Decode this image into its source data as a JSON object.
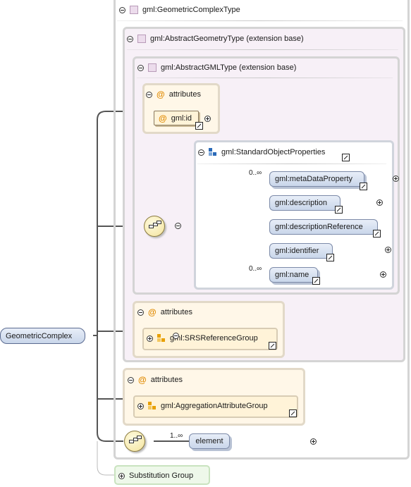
{
  "root": {
    "label": "GeometricComplex"
  },
  "complex_type": {
    "label": "gml:GeometricComplexType"
  },
  "abstract_geometry": {
    "label": "gml:AbstractGeometryType (extension base)"
  },
  "abstract_gml": {
    "label": "gml:AbstractGMLType (extension base)"
  },
  "gml_attributes": {
    "title": "attributes",
    "id_label": "gml:id"
  },
  "std_props": {
    "label": "gml:StandardObjectProperties",
    "items": [
      {
        "label": "gml:metaDataProperty",
        "occurs": "0..∞"
      },
      {
        "label": "gml:description",
        "occurs": ""
      },
      {
        "label": "gml:descriptionReference",
        "occurs": ""
      },
      {
        "label": "gml:identifier",
        "occurs": ""
      },
      {
        "label": "gml:name",
        "occurs": "0..∞"
      }
    ]
  },
  "geom_attributes": {
    "title": "attributes",
    "group_label": "gml:SRSReferenceGroup"
  },
  "complex_attributes": {
    "title": "attributes",
    "group_label": "gml:AggregationAttributeGroup"
  },
  "element_seq": {
    "occurs": "1..∞",
    "label": "element"
  },
  "substitution": {
    "label": "Substitution Group"
  },
  "colors": {
    "element_fill": "#c9d6ea",
    "attribute_fill": "#fff7e8",
    "type_fill": "#f7f0f7",
    "group_icon": "#e8a000",
    "accent_icon": "#2a6ab8"
  }
}
